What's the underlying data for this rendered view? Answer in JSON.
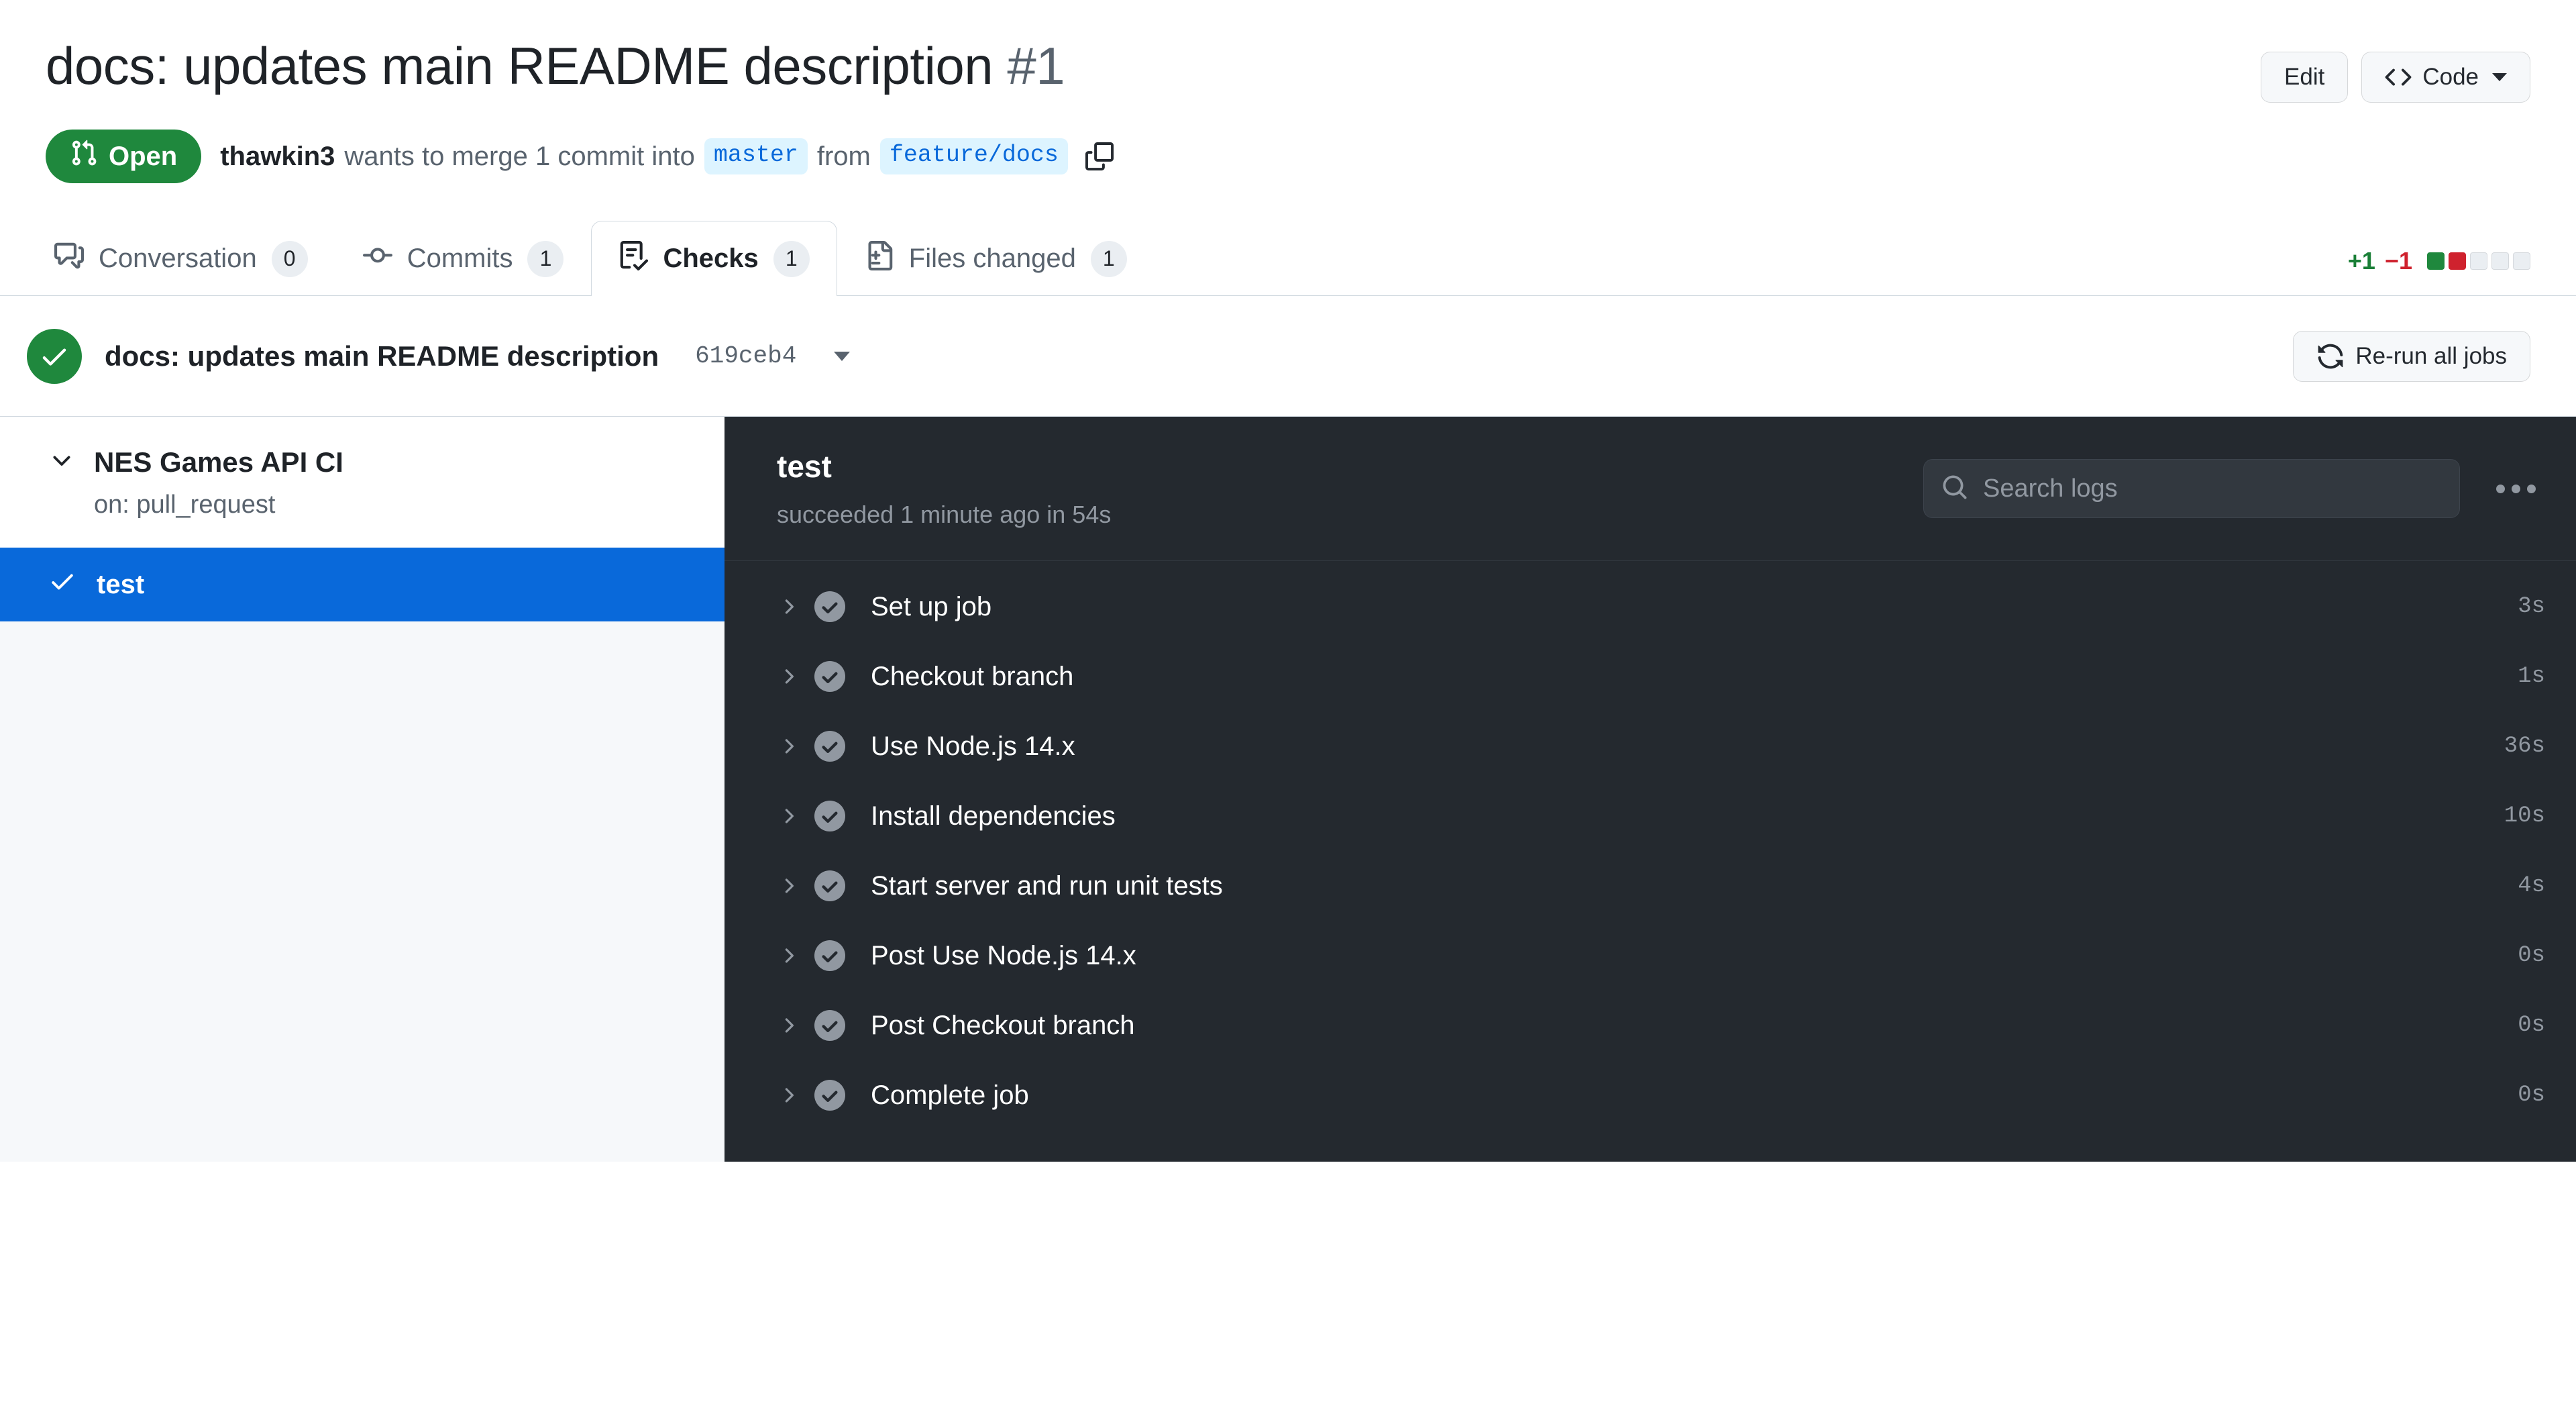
{
  "pr": {
    "title": "docs: updates main README description",
    "number": "#1",
    "state": "Open",
    "author": "thawkin3",
    "merge_text_1": "wants to merge 1 commit into",
    "base_branch": "master",
    "merge_text_2": "from",
    "head_branch": "feature/docs"
  },
  "header_actions": {
    "edit_label": "Edit",
    "code_label": "Code"
  },
  "tabs": [
    {
      "label": "Conversation",
      "count": "0",
      "icon": "comment-discussion-icon",
      "active": false
    },
    {
      "label": "Commits",
      "count": "1",
      "icon": "git-commit-icon",
      "active": false
    },
    {
      "label": "Checks",
      "count": "1",
      "icon": "checklist-icon",
      "active": true
    },
    {
      "label": "Files changed",
      "count": "1",
      "icon": "file-diff-icon",
      "active": false
    }
  ],
  "diffstat": {
    "additions": "+1",
    "deletions": "−1",
    "blocks": [
      "g",
      "r",
      "e",
      "e",
      "e"
    ]
  },
  "commit_bar": {
    "message": "docs: updates main README description",
    "sha": "619ceb4",
    "rerun_label": "Re-run all jobs"
  },
  "sidebar": {
    "workflow_name": "NES Games API CI",
    "workflow_trigger": "on: pull_request",
    "jobs": [
      {
        "name": "test",
        "status": "success",
        "selected": true
      }
    ]
  },
  "log_panel": {
    "job_title": "test",
    "job_status": "succeeded 1 minute ago in 54s",
    "search_placeholder": "Search logs",
    "steps": [
      {
        "name": "Set up job",
        "duration": "3s",
        "status": "success"
      },
      {
        "name": "Checkout branch",
        "duration": "1s",
        "status": "success"
      },
      {
        "name": "Use Node.js 14.x",
        "duration": "36s",
        "status": "success"
      },
      {
        "name": "Install dependencies",
        "duration": "10s",
        "status": "success"
      },
      {
        "name": "Start server and run unit tests",
        "duration": "4s",
        "status": "success"
      },
      {
        "name": "Post Use Node.js 14.x",
        "duration": "0s",
        "status": "success"
      },
      {
        "name": "Post Checkout branch",
        "duration": "0s",
        "status": "success"
      },
      {
        "name": "Complete job",
        "duration": "0s",
        "status": "success"
      }
    ]
  },
  "colors": {
    "open_green": "#1f883d",
    "accent_blue": "#0969da",
    "dark_panel": "#24292f",
    "add_green": "#1a7f37",
    "del_red": "#cf222e"
  }
}
